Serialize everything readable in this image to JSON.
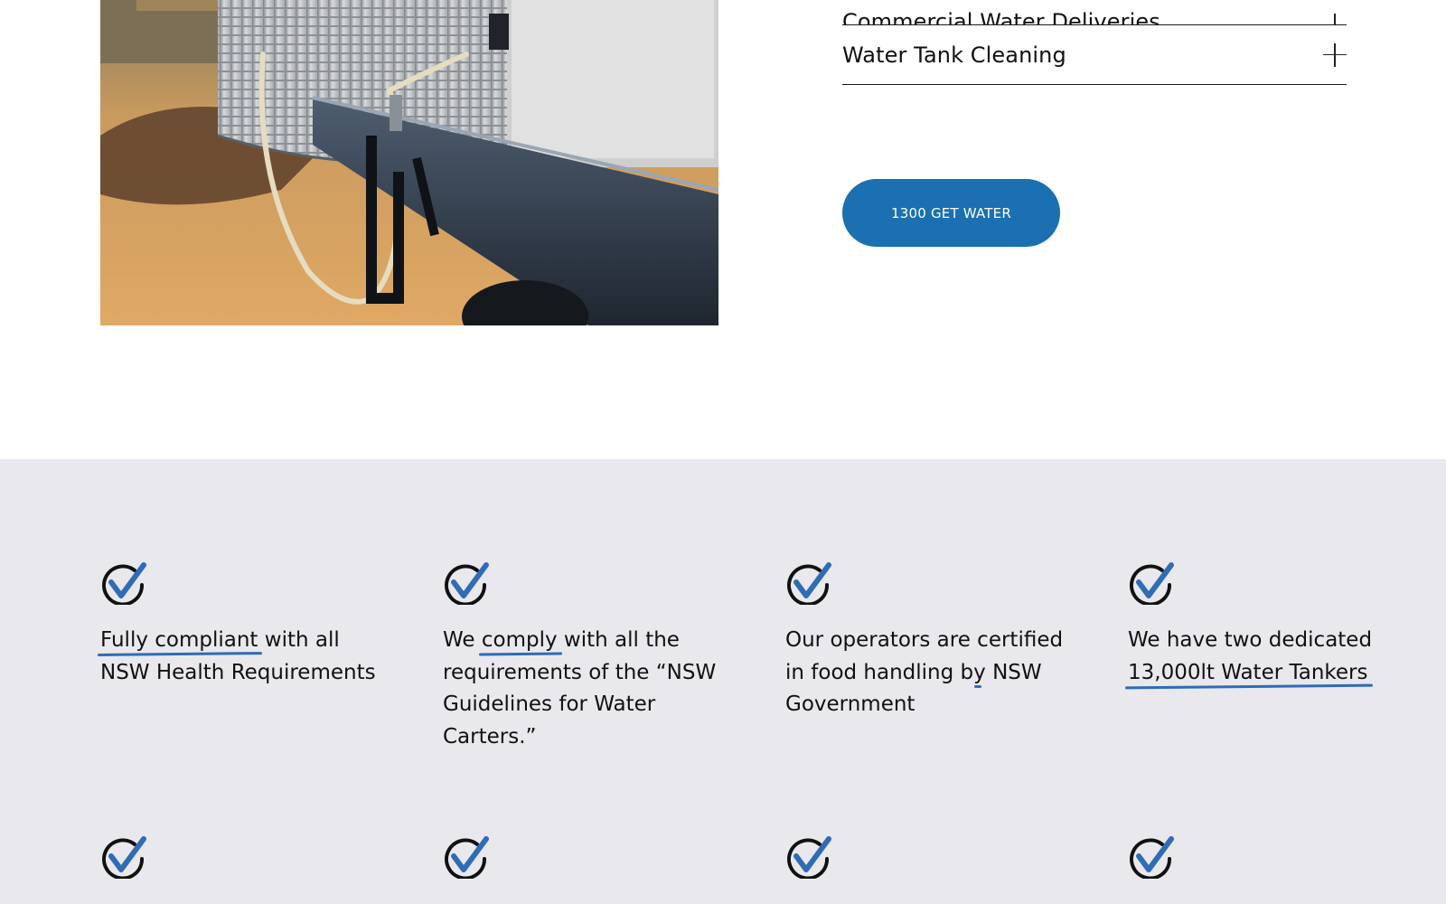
{
  "accordion": {
    "items": [
      {
        "label": "Commercial Water Deliveries"
      },
      {
        "label": "Water Tank Cleaning"
      }
    ]
  },
  "cta": {
    "label": "1300 GET WATER"
  },
  "features": [
    {
      "pre": "",
      "highlight": "Fully compliant",
      "post": " with all NSW Health Requirements"
    },
    {
      "pre": "We ",
      "highlight": "comply",
      "post": " with all the requirements of the “NSW Guidelines for Water Carters.”"
    },
    {
      "pre": "Our operators are ",
      "highlight": "certified in food handling",
      "post": " by NSW Government"
    },
    {
      "pre": "We have two dedicated ",
      "highlight": "13,000lt  Water Tankers",
      "post": ""
    }
  ],
  "colors": {
    "brand_blue": "#1a70b0",
    "underline_blue": "#2f6cb5",
    "section_background": "#e8e8ed"
  },
  "icons": {
    "feature_check": "check-circle-icon",
    "accordion_toggle": "plus-icon"
  }
}
